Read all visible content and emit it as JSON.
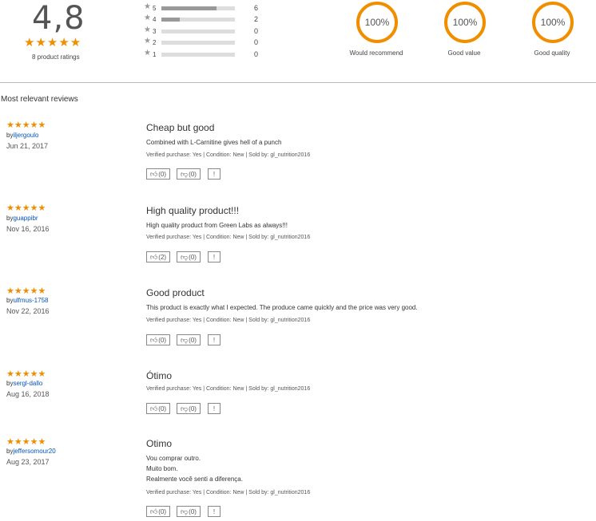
{
  "summary": {
    "average": "4,8",
    "stars": "★★★★★",
    "ratings_count": "8 product ratings",
    "histogram": [
      {
        "star": "5",
        "count": "6",
        "fraction": 0.75
      },
      {
        "star": "4",
        "count": "2",
        "fraction": 0.25
      },
      {
        "star": "3",
        "count": "0",
        "fraction": 0
      },
      {
        "star": "2",
        "count": "0",
        "fraction": 0
      },
      {
        "star": "1",
        "count": "0",
        "fraction": 0
      }
    ],
    "metrics": [
      {
        "value": "100%",
        "label": "Would recommend"
      },
      {
        "value": "100%",
        "label": "Good value"
      },
      {
        "value": "100%",
        "label": "Good quality"
      }
    ]
  },
  "section_title": "Most relevant reviews",
  "reviews": [
    {
      "stars": "★★★★★",
      "by": "by",
      "user": "iljergoulo",
      "date": "Jun 21, 2017",
      "title": "Cheap but good",
      "text": "Combined with L-Carnitine gives hell of a punch",
      "meta": "Verified purchase: Yes | Condition: New | Sold by: gl_nutrition2016",
      "helpful": "0",
      "unhelpful": "0",
      "report": "!"
    },
    {
      "stars": "★★★★★",
      "by": "by",
      "user": "guappibr",
      "date": "Nov 16, 2016",
      "title": "High quality product!!!",
      "text": "High quality product from Green Labs as always!!!",
      "meta": "Verified purchase: Yes | Condition: New | Sold by: gl_nutrition2016",
      "helpful": "2",
      "unhelpful": "0",
      "report": "!"
    },
    {
      "stars": "★★★★★",
      "by": "by",
      "user": "ulfmus-1758",
      "date": "Nov 22, 2016",
      "title": "Good product",
      "text": "This product is exactly what I expected. The produce came quickly and the price was very good.",
      "meta": "Verified purchase: Yes | Condition: New | Sold by: gl_nutrition2016",
      "helpful": "0",
      "unhelpful": "0",
      "report": "!"
    },
    {
      "stars": "★★★★★",
      "by": "by",
      "user": "sergl-dallo",
      "date": "Aug 16, 2018",
      "title": "Ótimo",
      "text": "",
      "meta": "Verified purchase: Yes | Condition: New | Sold by: gl_nutrition2016",
      "helpful": "0",
      "unhelpful": "0",
      "report": "!"
    },
    {
      "stars": "★★★★★",
      "by": "by",
      "user": "jeffersomour20",
      "date": "Aug 23, 2017",
      "title": "Otimo",
      "text_lines": [
        "Vou comprar outro.",
        "Muito bom.",
        "Realmente você senti a diferença."
      ],
      "meta": "Verified purchase: Yes | Condition: New | Sold by: gl_nutrition2016",
      "helpful": "0",
      "unhelpful": "0",
      "report": "!"
    }
  ],
  "colors": {
    "accent": "#f18e00",
    "link": "#0654ba"
  }
}
